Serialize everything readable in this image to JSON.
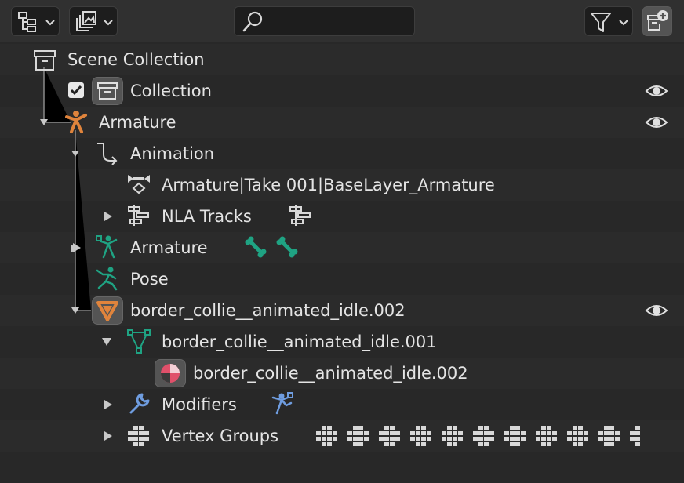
{
  "colors": {
    "background": "#282828",
    "header": "#303030",
    "text": "#e4e4e4",
    "armature_orange": "#e0843c",
    "data_green": "#1fa383",
    "modifier_blue": "#6f9de0",
    "material_red": "#e0506a"
  },
  "header": {
    "display_mode_icon": "outliner-display-icon",
    "filter_icon": "funnel-icon",
    "new_collection_icon": "new-collection-icon",
    "search": {
      "placeholder": "",
      "value": ""
    }
  },
  "tree": {
    "scene_collection": "Scene Collection",
    "collection": "Collection",
    "armature_object": "Armature",
    "animation": "Animation",
    "action": "Armature|Take 001|BaseLayer_Armature",
    "nla_tracks": "NLA Tracks",
    "armature_data": "Armature",
    "pose": "Pose",
    "mesh_object": "border_collie__animated_idle.002",
    "mesh_data": "border_collie__animated_idle.001",
    "material": "border_collie__animated_idle.002",
    "modifiers": "Modifiers",
    "vertex_groups": "Vertex Groups"
  }
}
